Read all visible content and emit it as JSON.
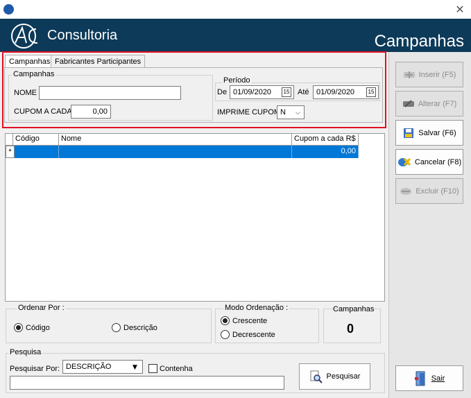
{
  "window": {
    "close_glyph": "✕"
  },
  "header": {
    "company": "Consultoria",
    "title": "Campanhas",
    "bg_color": "#0d3a59"
  },
  "tabs": [
    {
      "label": "Campanhas"
    },
    {
      "label": "Fabricantes Participantes"
    }
  ],
  "form": {
    "campanhas_group": "Campanhas",
    "nome_label": "NOME",
    "nome_value": "",
    "cupom_label": "CUPOM A CADA",
    "cupom_value": "0,00",
    "periodo_group": "Período",
    "de_label": "De",
    "de_value": "01/09/2020",
    "ate_label": "Até",
    "ate_value": "01/09/2020",
    "calendar_glyph": "15",
    "imprime_label": "IMPRIME CUPOM",
    "imprime_value": "N"
  },
  "grid": {
    "columns": [
      "Código",
      "Nome",
      "Cupom a cada R$"
    ],
    "row_indicator": "*",
    "rows": [
      {
        "codigo": "",
        "nome": "",
        "cupom": "0,00"
      }
    ],
    "selection_color": "#0078d7"
  },
  "ordenar": {
    "label": "Ordenar Por :",
    "option1": "Código",
    "option2": "Descrição",
    "selected": "Código"
  },
  "modo": {
    "label": "Modo Ordenação :",
    "option1": "Crescente",
    "option2": "Decrescente",
    "selected": "Crescente"
  },
  "stats": {
    "label": "Campanhas",
    "count": "0"
  },
  "pesquisa": {
    "group": "Pesquisa",
    "por_label": "Pesquisar Por:",
    "por_value": "DESCRIÇÃO",
    "contenha_label": "Contenha",
    "search_value": "",
    "button_label": "Pesquisar"
  },
  "sidebar": {
    "inserir": "Inserir (F5)",
    "alterar": "Alterar (F7)",
    "salvar": "Salvar (F6)",
    "cancelar": "Cancelar (F8)",
    "excluir": "Excluir (F10)",
    "sair": "Sair"
  }
}
